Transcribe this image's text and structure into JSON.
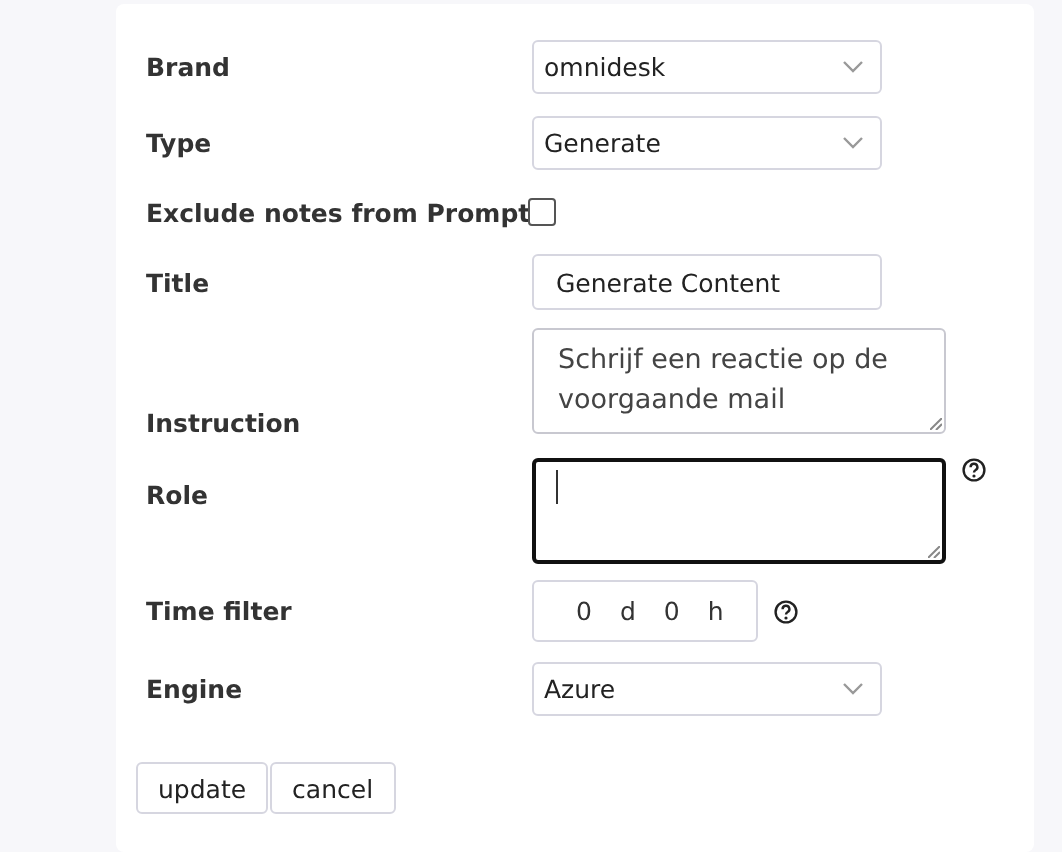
{
  "fields": [
    {
      "kind": "select",
      "label": "Brand",
      "value": "omnidesk"
    },
    {
      "kind": "select",
      "label": "Type",
      "value": "Generate"
    },
    {
      "kind": "checkbox",
      "label": "Exclude notes from Prompt",
      "checked": false
    },
    {
      "kind": "text",
      "label": "Title",
      "value": "Generate Content"
    },
    {
      "kind": "textarea",
      "label": "Instruction",
      "value": "Schrijf een reactie op de voorgaande mail",
      "focused": false,
      "help": false
    },
    {
      "kind": "textarea",
      "label": "Role",
      "focused": true,
      "help": true
    },
    {
      "kind": "duration",
      "label": "Time filter",
      "days": "0",
      "day_unit": "d",
      "hours": "0",
      "hour_unit": "h",
      "help": true
    },
    {
      "kind": "select",
      "label": "Engine",
      "value": "Azure"
    }
  ],
  "buttons": [
    "update",
    "cancel"
  ]
}
